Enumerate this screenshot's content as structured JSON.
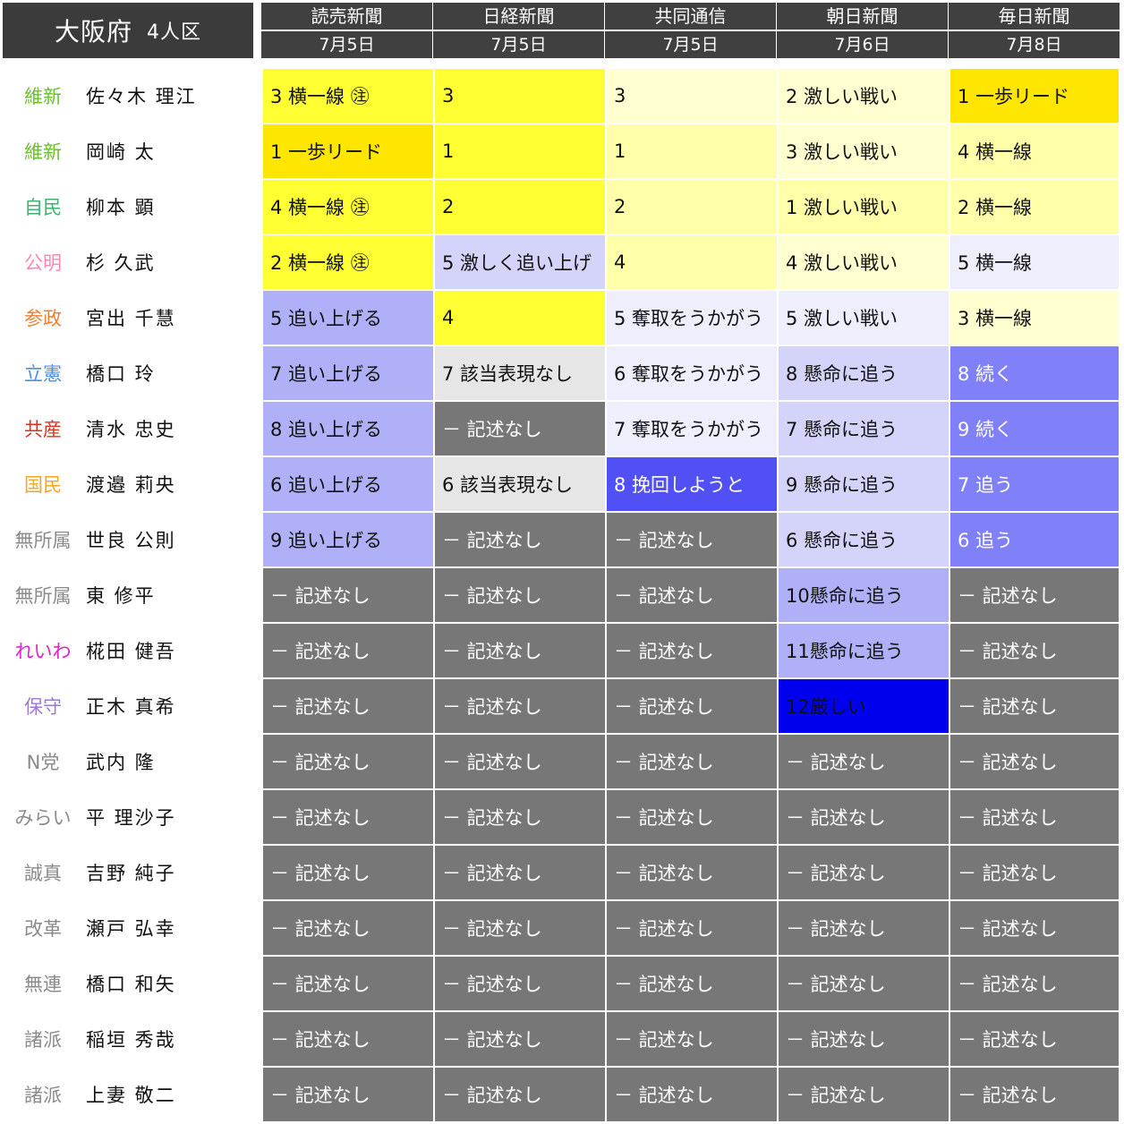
{
  "title": {
    "prefecture": "大阪府",
    "seats": "4人区"
  },
  "columns": [
    {
      "paper": "読売新聞",
      "date": "7月5日"
    },
    {
      "paper": "日経新聞",
      "date": "7月5日"
    },
    {
      "paper": "共同通信",
      "date": "7月5日"
    },
    {
      "paper": "朝日新聞",
      "date": "7月6日"
    },
    {
      "paper": "毎日新聞",
      "date": "7月8日"
    }
  ],
  "colors": {
    "header_bg": "#404040",
    "title_bg": "#3b3b3b",
    "none_bg": "#777777",
    "lead_bg": "#ffe600",
    "yellow_bg": "#ffff33",
    "lightyellow_bg": "#ffffaa",
    "paleyellow_bg": "#ffffd0",
    "lavender_bg": "#b0b0f8",
    "palelavender_bg": "#d4d4fb",
    "verypalelavender_bg": "#eeeefd",
    "gray_bg": "#e6e6e6",
    "blue_bg": "#8080f8",
    "strongblue_bg": "#5050f5",
    "deepblue_bg": "#0000ee"
  },
  "rows": [
    {
      "party": "維新",
      "party_color": "#6abf2a",
      "candidate": "佐々木 理江",
      "cells": [
        {
          "text": "3 横一線 ㊟",
          "tone": "yellow"
        },
        {
          "text": "3",
          "tone": "yellow"
        },
        {
          "text": "3",
          "tone": "paleyellow"
        },
        {
          "text": "2 激しい戦い",
          "tone": "paleyellow"
        },
        {
          "text": "1 一歩リード",
          "tone": "lead"
        }
      ]
    },
    {
      "party": "維新",
      "party_color": "#6abf2a",
      "candidate": "岡崎 太",
      "cells": [
        {
          "text": "1 一歩リード",
          "tone": "lead"
        },
        {
          "text": "1",
          "tone": "yellow"
        },
        {
          "text": "1",
          "tone": "lightyellow"
        },
        {
          "text": "3 激しい戦い",
          "tone": "paleyellow"
        },
        {
          "text": "4 横一線",
          "tone": "lightyellow"
        }
      ]
    },
    {
      "party": "自民",
      "party_color": "#3cb371",
      "candidate": "柳本 顕",
      "cells": [
        {
          "text": "4 横一線 ㊟",
          "tone": "yellow"
        },
        {
          "text": "2",
          "tone": "yellow"
        },
        {
          "text": "2",
          "tone": "lightyellow"
        },
        {
          "text": "1 激しい戦い",
          "tone": "lightyellow"
        },
        {
          "text": "2 横一線",
          "tone": "lightyellow"
        }
      ]
    },
    {
      "party": "公明",
      "party_color": "#ff88b0",
      "candidate": "杉 久武",
      "cells": [
        {
          "text": "2 横一線 ㊟",
          "tone": "yellow"
        },
        {
          "text": "5 激しく追い上げ",
          "tone": "palelavender"
        },
        {
          "text": "4",
          "tone": "lightyellow"
        },
        {
          "text": "4 激しい戦い",
          "tone": "paleyellow"
        },
        {
          "text": "5 横一線",
          "tone": "verypalelavender"
        }
      ]
    },
    {
      "party": "参政",
      "party_color": "#f08030",
      "candidate": "宮出 千慧",
      "cells": [
        {
          "text": "5 追い上げる",
          "tone": "lavender"
        },
        {
          "text": "4",
          "tone": "yellow"
        },
        {
          "text": "5 奪取をうかがう",
          "tone": "verypalelavender"
        },
        {
          "text": "5 激しい戦い",
          "tone": "verypalelavender"
        },
        {
          "text": "3 横一線",
          "tone": "paleyellow"
        }
      ]
    },
    {
      "party": "立憲",
      "party_color": "#4a8fe0",
      "candidate": "橋口 玲",
      "cells": [
        {
          "text": "7 追い上げる",
          "tone": "lavender"
        },
        {
          "text": "7 該当表現なし",
          "tone": "gray"
        },
        {
          "text": "6 奪取をうかがう",
          "tone": "verypalelavender"
        },
        {
          "text": "8 懸命に追う",
          "tone": "palelavender"
        },
        {
          "text": "8 続く",
          "tone": "blue"
        }
      ]
    },
    {
      "party": "共産",
      "party_color": "#e0301e",
      "candidate": "清水 忠史",
      "cells": [
        {
          "text": "8 追い上げる",
          "tone": "lavender"
        },
        {
          "text": "－ 記述なし",
          "tone": "none"
        },
        {
          "text": "7 奪取をうかがう",
          "tone": "verypalelavender"
        },
        {
          "text": "7 懸命に追う",
          "tone": "palelavender"
        },
        {
          "text": "9 続く",
          "tone": "blue"
        }
      ]
    },
    {
      "party": "国民",
      "party_color": "#f5a623",
      "candidate": "渡邉 莉央",
      "cells": [
        {
          "text": "6 追い上げる",
          "tone": "lavender"
        },
        {
          "text": "6 該当表現なし",
          "tone": "gray"
        },
        {
          "text": "8 挽回しようと",
          "tone": "strongblue"
        },
        {
          "text": "9 懸命に追う",
          "tone": "palelavender"
        },
        {
          "text": "7 追う",
          "tone": "blue"
        }
      ]
    },
    {
      "party": "無所属",
      "party_color": "#8a8a8a",
      "candidate": "世良 公則",
      "cells": [
        {
          "text": "9 追い上げる",
          "tone": "lavender"
        },
        {
          "text": "－ 記述なし",
          "tone": "none"
        },
        {
          "text": "－ 記述なし",
          "tone": "none"
        },
        {
          "text": "6 懸命に追う",
          "tone": "palelavender"
        },
        {
          "text": "6 追う",
          "tone": "blue"
        }
      ]
    },
    {
      "party": "無所属",
      "party_color": "#8a8a8a",
      "candidate": "東 修平",
      "cells": [
        {
          "text": "－ 記述なし",
          "tone": "none"
        },
        {
          "text": "－ 記述なし",
          "tone": "none"
        },
        {
          "text": "－ 記述なし",
          "tone": "none"
        },
        {
          "text": "10懸命に追う",
          "tone": "lavender"
        },
        {
          "text": "－ 記述なし",
          "tone": "none"
        }
      ]
    },
    {
      "party": "れいわ",
      "party_color": "#e020c8",
      "candidate": "椛田 健吾",
      "cells": [
        {
          "text": "－ 記述なし",
          "tone": "none"
        },
        {
          "text": "－ 記述なし",
          "tone": "none"
        },
        {
          "text": "－ 記述なし",
          "tone": "none"
        },
        {
          "text": "11懸命に追う",
          "tone": "lavender"
        },
        {
          "text": "－ 記述なし",
          "tone": "none"
        }
      ]
    },
    {
      "party": "保守",
      "party_color": "#9a7ad8",
      "candidate": "正木 真希",
      "cells": [
        {
          "text": "－ 記述なし",
          "tone": "none"
        },
        {
          "text": "－ 記述なし",
          "tone": "none"
        },
        {
          "text": "－ 記述なし",
          "tone": "none"
        },
        {
          "text": "12厳しい",
          "tone": "deepblue"
        },
        {
          "text": "－ 記述なし",
          "tone": "none"
        }
      ]
    },
    {
      "party": "N党",
      "party_color": "#8a8a8a",
      "candidate": "武内 隆",
      "cells": [
        {
          "text": "－ 記述なし",
          "tone": "none"
        },
        {
          "text": "－ 記述なし",
          "tone": "none"
        },
        {
          "text": "－ 記述なし",
          "tone": "none"
        },
        {
          "text": "－ 記述なし",
          "tone": "none"
        },
        {
          "text": "－ 記述なし",
          "tone": "none"
        }
      ]
    },
    {
      "party": "みらい",
      "party_color": "#8a8a8a",
      "candidate": "平 理沙子",
      "cells": [
        {
          "text": "－ 記述なし",
          "tone": "none"
        },
        {
          "text": "－ 記述なし",
          "tone": "none"
        },
        {
          "text": "－ 記述なし",
          "tone": "none"
        },
        {
          "text": "－ 記述なし",
          "tone": "none"
        },
        {
          "text": "－ 記述なし",
          "tone": "none"
        }
      ]
    },
    {
      "party": "誠真",
      "party_color": "#8a8a8a",
      "candidate": "吉野 純子",
      "cells": [
        {
          "text": "－ 記述なし",
          "tone": "none"
        },
        {
          "text": "－ 記述なし",
          "tone": "none"
        },
        {
          "text": "－ 記述なし",
          "tone": "none"
        },
        {
          "text": "－ 記述なし",
          "tone": "none"
        },
        {
          "text": "－ 記述なし",
          "tone": "none"
        }
      ]
    },
    {
      "party": "改革",
      "party_color": "#8a8a8a",
      "candidate": "瀬戸 弘幸",
      "cells": [
        {
          "text": "－ 記述なし",
          "tone": "none"
        },
        {
          "text": "－ 記述なし",
          "tone": "none"
        },
        {
          "text": "－ 記述なし",
          "tone": "none"
        },
        {
          "text": "－ 記述なし",
          "tone": "none"
        },
        {
          "text": "－ 記述なし",
          "tone": "none"
        }
      ]
    },
    {
      "party": "無連",
      "party_color": "#8a8a8a",
      "candidate": "橋口 和矢",
      "cells": [
        {
          "text": "－ 記述なし",
          "tone": "none"
        },
        {
          "text": "－ 記述なし",
          "tone": "none"
        },
        {
          "text": "－ 記述なし",
          "tone": "none"
        },
        {
          "text": "－ 記述なし",
          "tone": "none"
        },
        {
          "text": "－ 記述なし",
          "tone": "none"
        }
      ]
    },
    {
      "party": "諸派",
      "party_color": "#8a8a8a",
      "candidate": "稲垣 秀哉",
      "cells": [
        {
          "text": "－ 記述なし",
          "tone": "none"
        },
        {
          "text": "－ 記述なし",
          "tone": "none"
        },
        {
          "text": "－ 記述なし",
          "tone": "none"
        },
        {
          "text": "－ 記述なし",
          "tone": "none"
        },
        {
          "text": "－ 記述なし",
          "tone": "none"
        }
      ]
    },
    {
      "party": "諸派",
      "party_color": "#8a8a8a",
      "candidate": "上妻 敬二",
      "cells": [
        {
          "text": "－ 記述なし",
          "tone": "none"
        },
        {
          "text": "－ 記述なし",
          "tone": "none"
        },
        {
          "text": "－ 記述なし",
          "tone": "none"
        },
        {
          "text": "－ 記述なし",
          "tone": "none"
        },
        {
          "text": "－ 記述なし",
          "tone": "none"
        }
      ]
    }
  ]
}
